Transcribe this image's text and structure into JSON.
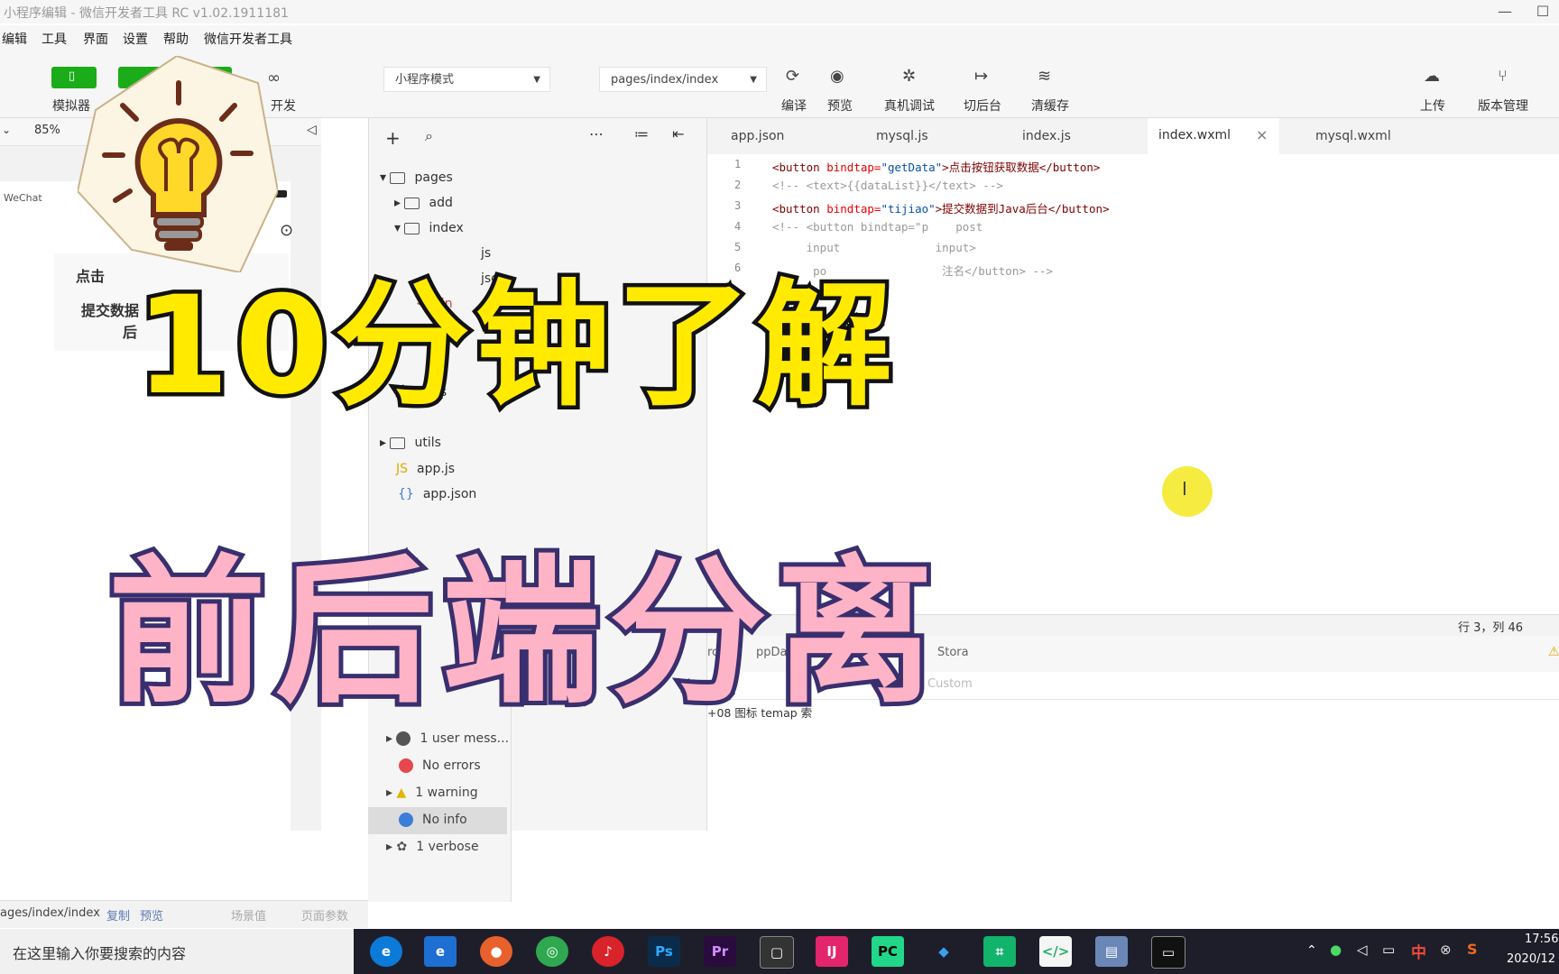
{
  "titlebar": {
    "title": "小程序编辑 - 微信开发者工具 RC v1.02.1911181"
  },
  "menu": [
    "编辑",
    "工具",
    "界面",
    "设置",
    "帮助",
    "微信开发者工具"
  ],
  "toolbar": {
    "simulator_label": "模拟器",
    "mode_select": "小程序模式",
    "page_select": "pages/index/index",
    "compile": "编译",
    "preview": "预览",
    "real_debug": "真机调试",
    "background": "切后台",
    "clear_cache": "清缓存",
    "upload": "上传",
    "version": "版本管理",
    "dev_partial": "开发"
  },
  "simulator": {
    "zoom": "85%",
    "wechat": "WeChat",
    "btn1_partial": "点击",
    "btn2_partial": "提交数据",
    "btn2_line2": "后"
  },
  "tree": {
    "pages": "pages",
    "add": "add",
    "index": "index",
    "index_js": "js",
    "index_json": "json",
    "index_wxml": "in",
    "logs_partial": "gs",
    "utils": "utils",
    "app_js": "app.js",
    "app_json": "app.json"
  },
  "tabs": [
    "app.json",
    "mysql.js",
    "index.js",
    "index.wxml",
    "mysql.wxml"
  ],
  "code": {
    "line_numbers": [
      "1",
      "2",
      "3",
      "4",
      "5",
      "6"
    ],
    "l1_open": "<button ",
    "l1_attr": "bindtap=",
    "l1_val": "\"getData\"",
    "l1_text": ">点击按钮获取数据</button>",
    "l2": "<!-- <text>{{dataList}}</text> -->",
    "l3_open": "<button ",
    "l3_attr": "bindtap=",
    "l3_val": "\"tijiao\"",
    "l3_text": ">提交数据到Java后台</button>",
    "l4": "<!-- <button bindtap=\"p    post",
    "l5": "     input              input>",
    "l6": "      po                 注名</button> -->"
  },
  "status": {
    "position": "行 3，列 46"
  },
  "debug": {
    "tab_source_partial": "rce",
    "tab_appdata_partial": "ppData",
    "tab_storage_partial": "Stora",
    "filter_placeholder_partial": "Custom",
    "log_partial": "+08       图标    temap  索"
  },
  "console": {
    "user": "1 user mess...",
    "errors": "No errors",
    "warning": "1 warning",
    "info": "No info",
    "verbose": "1 verbose"
  },
  "pathbar": {
    "path": "ages/index/index",
    "copy": "复制",
    "preview": "预览",
    "scene": "场景值",
    "params": "页面参数"
  },
  "taskbar": {
    "search_placeholder": "在这里输入你要搜索的内容",
    "time": "17:56",
    "date": "2020/12",
    "ime": "中"
  },
  "overlay": {
    "headline1": "10分钟了解",
    "headline2": "前后端分离"
  },
  "colors": {
    "accent_green": "#1aad19",
    "headline1_fill": "#ffea00",
    "headline2_fill": "#ffb3c6",
    "headline2_stroke": "#3a2f6e"
  }
}
